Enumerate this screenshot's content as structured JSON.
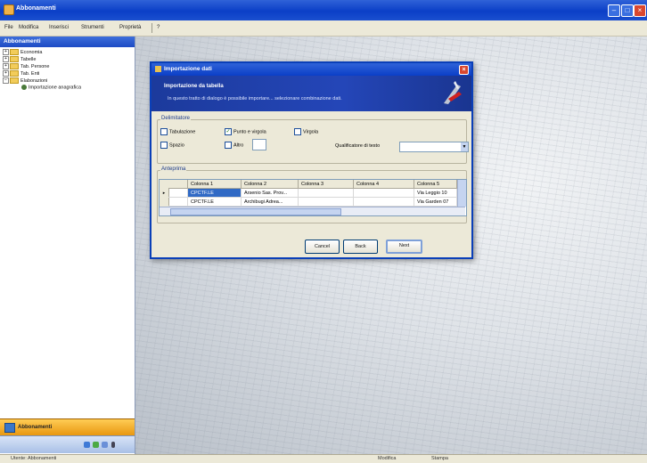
{
  "window": {
    "title": "Abbonamenti"
  },
  "menu": {
    "items": [
      "File",
      "Modifica",
      "Inserisci",
      "Strumenti",
      "Proprietà",
      "?"
    ]
  },
  "sidebar": {
    "header": "Abbonamenti",
    "tree": [
      {
        "label": "Economia",
        "type": "folder",
        "level": 0
      },
      {
        "label": "Tabelle",
        "type": "folder",
        "level": 0
      },
      {
        "label": "Tab. Persone",
        "type": "folder",
        "level": 0
      },
      {
        "label": "Tab. Enti",
        "type": "folder",
        "level": 0
      },
      {
        "label": "Elaborazioni",
        "type": "folder",
        "level": 0
      },
      {
        "label": "Importazione anagrafica",
        "type": "gear",
        "level": 1
      }
    ],
    "nav_pane_label": "Abbonamenti"
  },
  "status": {
    "left": "Utente: Abbonamenti",
    "middle": "Modifica",
    "right": "Stampa"
  },
  "dialog": {
    "title": "Importazione dati",
    "banner_heading": "Importazione da tabella",
    "banner_desc": "In questo tratto di dialogo è possibile importare... selezionare combinazione dati.",
    "group_delimiter": "Delimitatore",
    "opt_tab": "Tabulazione",
    "opt_semicolon": "Punto e virgola",
    "opt_comma": "Virgola",
    "opt_space": "Spazio",
    "opt_other": "Altro",
    "text_qualifier_label": "Qualificatore di testo",
    "group_preview": "Anteprima",
    "columns": [
      "Colonna 1",
      "Colonna 2",
      "Colonna 3",
      "Colonna 4",
      "Colonna 5"
    ],
    "rows": [
      [
        "CPCTF.LE",
        "Arsenio Sas. Prov...",
        "",
        "",
        "Via Leggio 10"
      ],
      [
        "CPCTF.LE",
        "Archibugi Adrea...",
        "",
        "",
        "Via Garden 07"
      ]
    ],
    "btn_cancel": "Cancel",
    "btn_back": "Back",
    "btn_next": "Next"
  },
  "colors": {
    "title_blue": "#0b3fc7",
    "banner_blue": "#2446b8",
    "xp_face": "#ece9d8",
    "selection": "#316ac5",
    "nav_orange": "#e89710"
  }
}
